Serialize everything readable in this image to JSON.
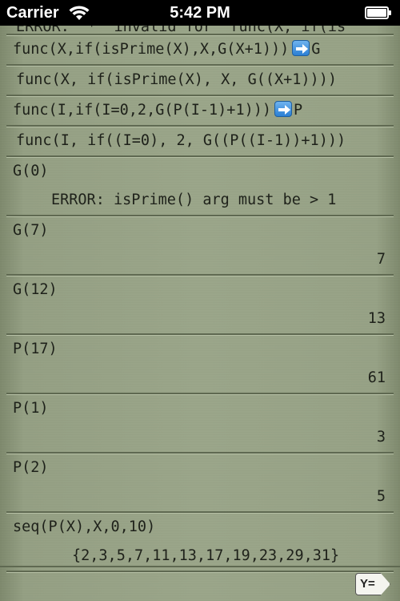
{
  "status_bar": {
    "carrier": "Carrier",
    "time": "5:42 PM"
  },
  "history": {
    "error_top": "ERROR: '*' invalid for 'func(X, if(is",
    "def1_input": "func(X,if(isPrime(X),X,G(X+1)))",
    "def1_target": "G",
    "def1_echo": "func(X, if(isPrime(X), X, G((X+1))))",
    "def2_input": "func(I,if(I=0,2,G(P(I-1)+1)))",
    "def2_target": "P",
    "def2_echo": "func(I, if((I=0), 2, G((P((I-1))+1)))",
    "entries": [
      {
        "input": "G(0)",
        "output": "ERROR: isPrime() arg must be > 1"
      },
      {
        "input": "G(7)",
        "output": "7"
      },
      {
        "input": "G(12)",
        "output": "13"
      },
      {
        "input": "P(17)",
        "output": "61"
      },
      {
        "input": "P(1)",
        "output": "3"
      },
      {
        "input": "P(2)",
        "output": "5"
      },
      {
        "input": "seq(P(X),X,0,10)",
        "output": "{2,3,5,7,11,13,17,19,23,29,31}"
      }
    ]
  },
  "toolbar": {
    "y_button_label": "Y="
  }
}
